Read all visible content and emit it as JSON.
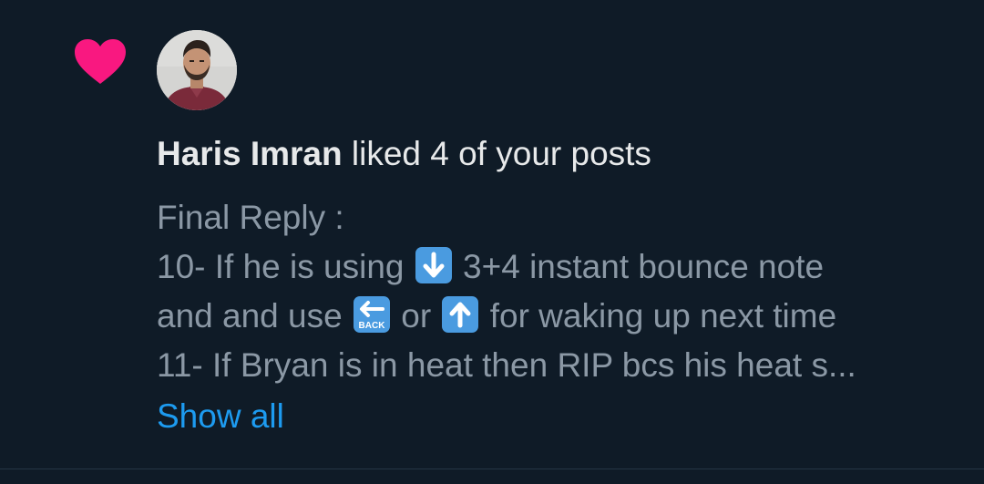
{
  "notification": {
    "user_name": "Haris Imran",
    "action_text": "liked 4 of your posts",
    "post_lines": {
      "line1": "Final Reply :",
      "line2_a": "10- If he is using",
      "line2_b": "3+4 instant bounce note",
      "line3_a": "and and use",
      "line3_b": "or",
      "line3_c": "for waking up next time",
      "line4": "11- If Bryan is in heat then RIP bcs his heat s..."
    },
    "emojis": {
      "down_arrow": "down-arrow-key-icon",
      "back_arrow": "back-arrow-key-icon",
      "back_label": "BACK",
      "up_arrow": "up-arrow-key-icon"
    },
    "show_all_label": "Show all"
  },
  "colors": {
    "background": "#0f1b27",
    "heart": "#f91880",
    "link": "#1d9bf0",
    "primary_text": "#e7e9ea",
    "secondary_text": "#8b98a5"
  }
}
